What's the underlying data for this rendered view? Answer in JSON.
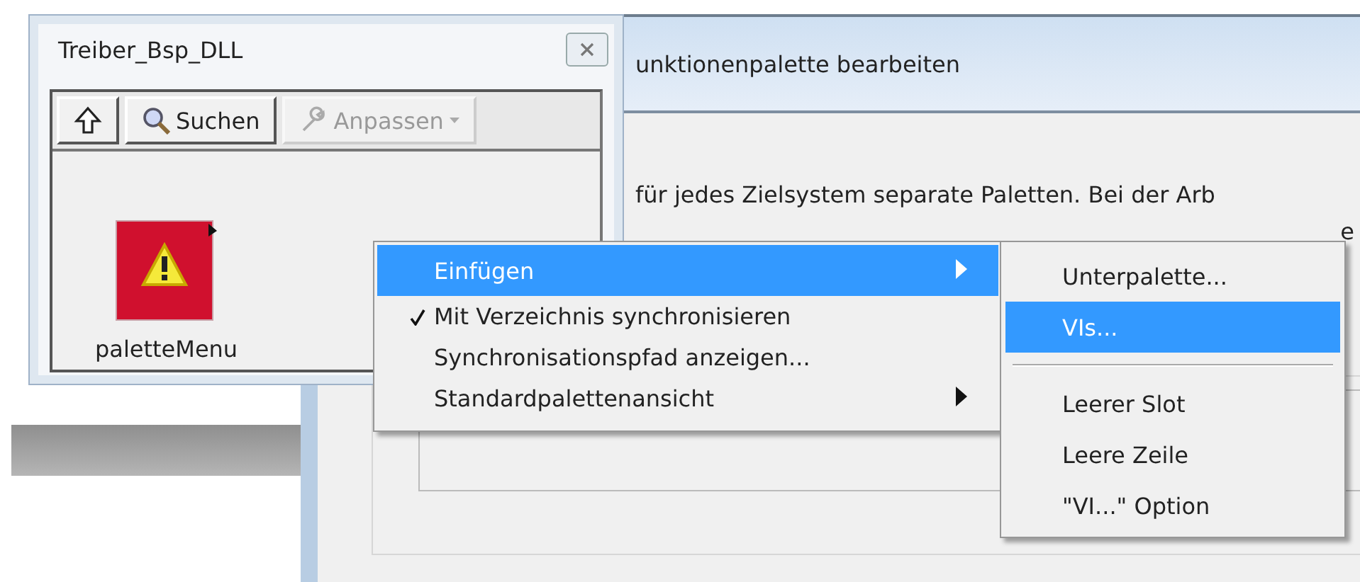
{
  "dialog": {
    "title": "unktionenpalette bearbeiten",
    "text": "für jedes Zielsystem separate Paletten. Bei der Arb",
    "text_fragment": "e"
  },
  "palette_window": {
    "title": "Treiber_Bsp_DLL",
    "toolbar": [
      {
        "kind": "up",
        "disabled": false
      },
      {
        "kind": "search",
        "label": "Suchen",
        "disabled": false
      },
      {
        "kind": "customize",
        "label": "Anpassen",
        "disabled": true
      }
    ],
    "items": [
      {
        "label": "paletteMenu"
      }
    ]
  },
  "context_menu": {
    "items": [
      {
        "label": "Einfügen",
        "selected": true,
        "checked": false,
        "submenu": true
      },
      {
        "label": "Mit Verzeichnis synchronisieren",
        "selected": false,
        "checked": true,
        "submenu": false
      },
      {
        "label": "Synchronisationspfad anzeigen...",
        "selected": false,
        "checked": false,
        "submenu": false
      },
      {
        "label": "Standardpalettenansicht",
        "selected": false,
        "checked": false,
        "submenu": true
      }
    ]
  },
  "submenu": {
    "items": [
      {
        "kind": "item",
        "label": "Unterpalette...",
        "selected": false
      },
      {
        "kind": "item",
        "label": "VIs...",
        "selected": true
      },
      {
        "kind": "separator"
      },
      {
        "kind": "item",
        "label": "Leerer Slot",
        "selected": false
      },
      {
        "kind": "item",
        "label": "Leere Zeile",
        "selected": false
      },
      {
        "kind": "item",
        "label": "\"VI...\" Option",
        "selected": false
      }
    ]
  }
}
